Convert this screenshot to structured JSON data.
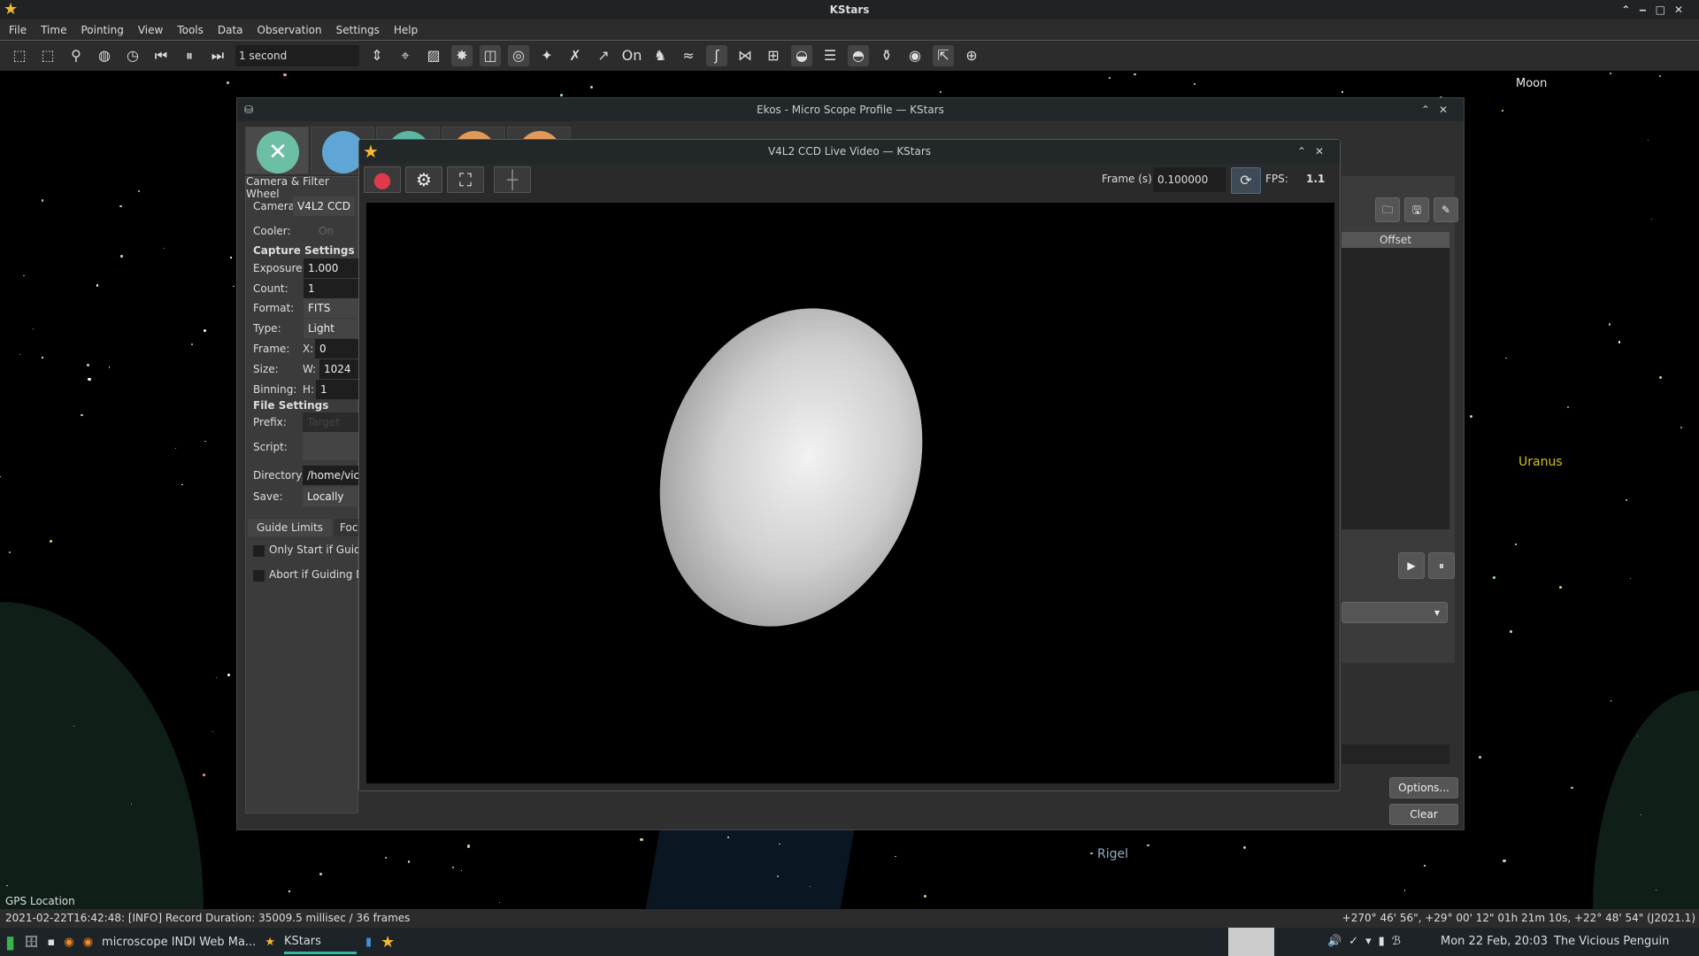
{
  "app": {
    "title": "KStars"
  },
  "menu": [
    "File",
    "Time",
    "Pointing",
    "View",
    "Tools",
    "Data",
    "Observation",
    "Settings",
    "Help"
  ],
  "toolbar": {
    "time_step": "1 second"
  },
  "sky": {
    "labels": {
      "moon": "Moon",
      "uranus": "Uranus",
      "rigel": "Rigel",
      "gps": "GPS Location"
    },
    "uranus_color": "#d4c21a"
  },
  "ekos": {
    "title": "Ekos - Micro Scope Profile — KStars",
    "module_title": "Camera & Filter Wheel",
    "camera_label": "Camera",
    "camera_value": "V4L2 CCD",
    "cooler_label": "Cooler:",
    "cooler_button": "On",
    "capture_settings": "Capture Settings",
    "exposure_label": "Exposure:",
    "exposure": "1.000",
    "count_label": "Count:",
    "count": "1",
    "format_label": "Format:",
    "format": "FITS",
    "type_label": "Type:",
    "type": "Light",
    "frame_label": "Frame:",
    "frame_x_label": "X:",
    "frame_x": "0",
    "size_label": "Size:",
    "size_w_label": "W:",
    "size_w": "1024",
    "binning_label": "Binning:",
    "binning_h_label": "H:",
    "binning_h": "1",
    "file_settings": "File Settings",
    "prefix_label": "Prefix:",
    "prefix_placeholder": "Target",
    "script_label": "Script:",
    "directory_label": "Directory:",
    "directory": "/home/vici",
    "save_label": "Save:",
    "save": "Locally",
    "tabs": [
      "Guide Limits",
      "Foc"
    ],
    "only_start": "Only Start if Guide",
    "abort_if": "Abort if Guiding D",
    "offset_header": "Offset",
    "options_button": "Options...",
    "clear_button": "Clear"
  },
  "video": {
    "title": "V4L2 CCD Live Video — KStars",
    "frame_label": "Frame (s)",
    "frame_value": "0.100000",
    "fps_label": "FPS:",
    "fps_value": "1.1"
  },
  "status": {
    "message": "2021-02-22T16:42:48: [INFO] Record Duration: 35009.5 millisec / 36 frames",
    "coords": "+270° 46' 56\", +29° 00' 12\"  01h 21m 10s, +22° 48' 54\" (J2021.1)"
  },
  "taskbar": {
    "task1": "microscope INDI Web Ma...",
    "task2": "KStars",
    "clock": "Mon 22 Feb, 20:03",
    "user": "The Vicious Penguin"
  }
}
